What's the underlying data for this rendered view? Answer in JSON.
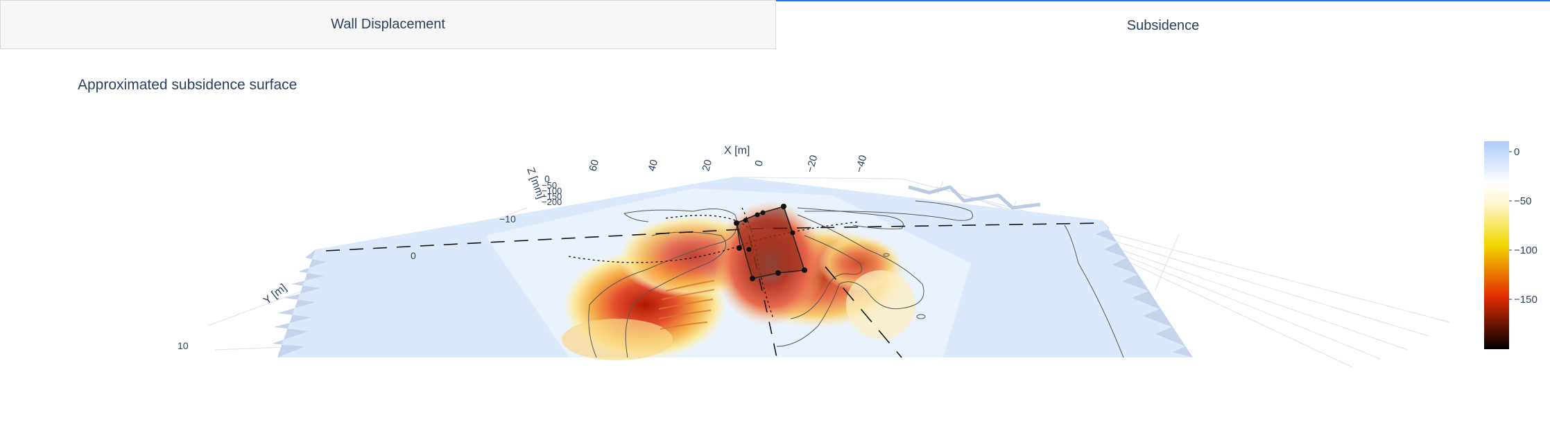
{
  "tabs": [
    {
      "label": "Wall Displacement",
      "active": false
    },
    {
      "label": "Subsidence",
      "active": true
    }
  ],
  "plot": {
    "title": "Approximated subsidence surface",
    "x_axis": {
      "label": "X [m]",
      "ticks": [
        "60",
        "40",
        "20",
        "0",
        "−20",
        "−40"
      ]
    },
    "y_axis": {
      "label": "Y [m]",
      "ticks": [
        "−10",
        "0",
        "10"
      ]
    },
    "z_axis": {
      "label": "Z [mm]",
      "ticks": [
        "0",
        "−50",
        "−100",
        "−150",
        "−200"
      ]
    },
    "colorbar": {
      "ticks": [
        "0",
        "−50",
        "−100",
        "−150"
      ],
      "colors": [
        "#aecbfa",
        "#ffffff",
        "#f2d600",
        "#e02b00",
        "#000000"
      ]
    }
  }
}
